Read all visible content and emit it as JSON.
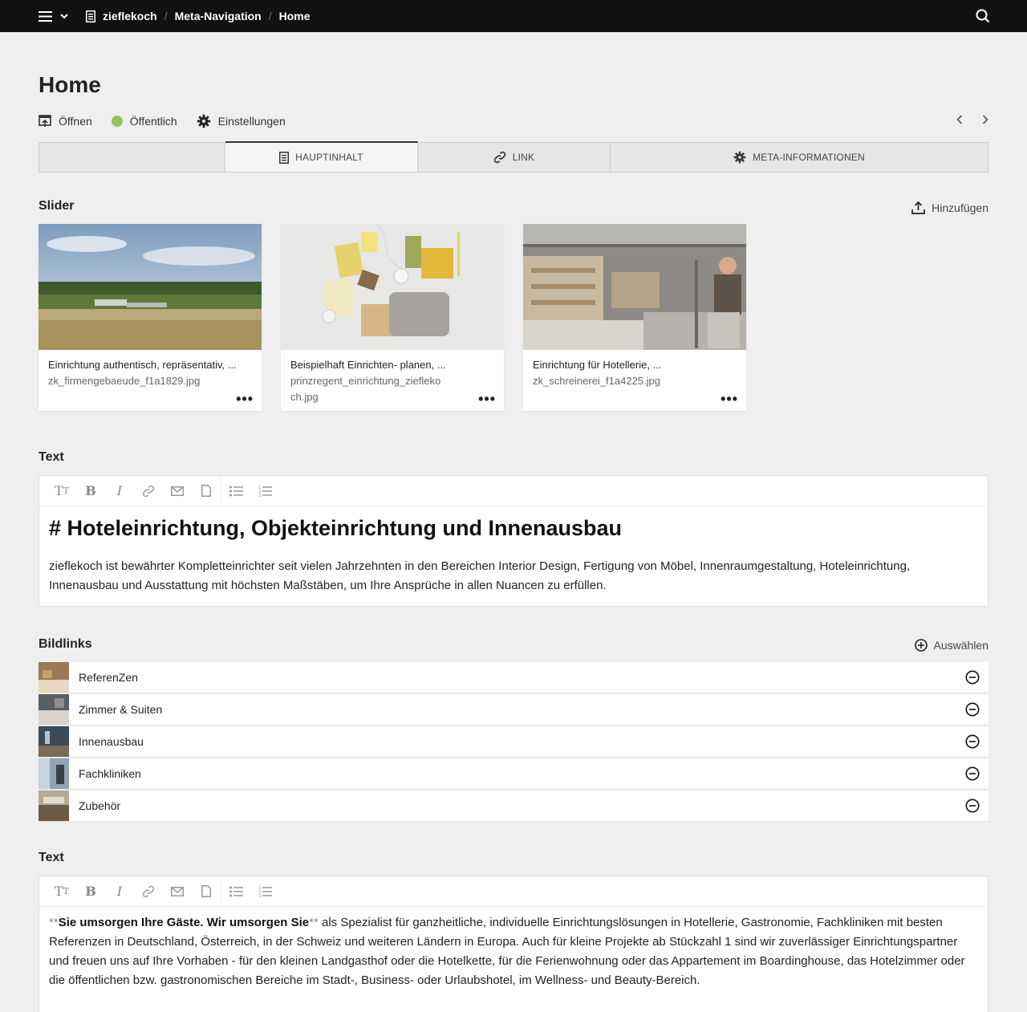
{
  "topbar": {
    "crumbs": [
      "zieflekoch",
      "Meta-Navigation",
      "Home"
    ]
  },
  "page": {
    "title": "Home",
    "actions": {
      "open": "Öffnen",
      "status": "Öffentlich",
      "settings": "Einstellungen"
    },
    "status_color": "#9cc159"
  },
  "tabs": [
    {
      "label": "HAUPTINHALT",
      "icon": "document-icon"
    },
    {
      "label": "LINK",
      "icon": "link-icon"
    },
    {
      "label": "META-INFORMATIONEN",
      "icon": "gear-icon"
    }
  ],
  "slider": {
    "label": "Slider",
    "add_label": "Hinzufügen",
    "items": [
      {
        "title": "Einrichtung authentisch, repräsentativ, ...",
        "file": "zk_firmengebaeude_f1a1829.jpg"
      },
      {
        "title": "Beispielhaft Einrichten- planen, ...",
        "file": "prinzregent_einrichtung_zieflekoch.jpg"
      },
      {
        "title": "Einrichtung für Hotellerie, ...",
        "file": "zk_schreinerei_f1a4225.jpg"
      }
    ]
  },
  "text1": {
    "label": "Text",
    "heading": "# Hoteleinrichtung, Objekteinrichtung und Innenausbau",
    "paragraph": "zieflekoch ist bewährter Kompletteinrichter seit vielen Jahrzehnten in den Bereichen Interior Design, Fertigung von Möbel, Innenraumgestaltung, Hoteleinrichtung, Innenausbau und Ausstattung mit höchsten Maßstäben, um Ihre Ansprüche in allen Nuancen zu erfüllen."
  },
  "bildlinks": {
    "label": "Bildlinks",
    "select_label": "Auswählen",
    "items": [
      "ReferenZen",
      "Zimmer & Suiten",
      "Innenausbau",
      "Fachkliniken",
      "Zubehör"
    ]
  },
  "text2": {
    "label": "Text",
    "md_open": "**",
    "bold": "Sie umsorgen Ihre Gäste. Wir umsorgen Sie",
    "md_close": "**",
    "rest": " als Spezialist für ganzheitliche, individuelle Einrichtungslösungen in Hotellerie, Gastronomie, Fachkliniken mit besten Referenzen in Deutschland, Österreich, in der Schweiz und weiteren Ländern in Europa. Auch für kleine Projekte ab Stückzahl 1 sind wir zuverlässiger Einrichtungspartner und freuen uns auf Ihre Vorhaben - für den kleinen Landgasthof oder die Hotelkette, für die Ferienwohnung oder das Appartement im Boardinghouse, das Hotelzimmer oder die öffentlichen bzw. gastronomischen Bereiche im Stadt-, Business- oder Urlaubshotel, im Wellness- und Beauty-Bereich."
  },
  "toolbar_icons": [
    "text-size-icon",
    "bold-icon",
    "italic-icon",
    "link-icon",
    "email-icon",
    "file-icon",
    "bullet-list-icon",
    "numbered-list-icon"
  ]
}
